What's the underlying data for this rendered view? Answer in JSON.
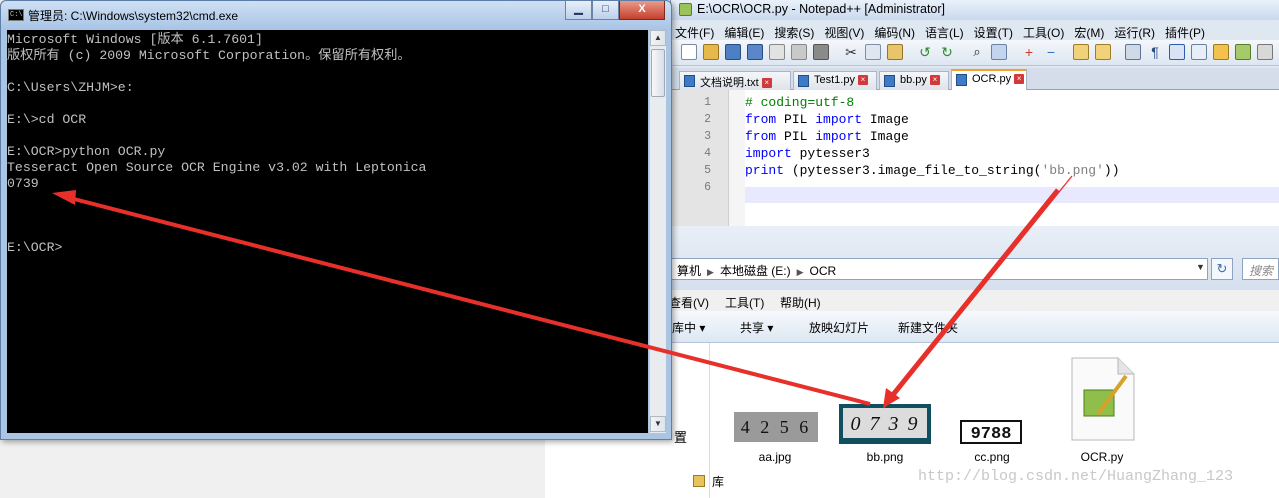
{
  "cmd": {
    "title": "管理员: C:\\Windows\\system32\\cmd.exe",
    "controls": {
      "minimize": "▁",
      "maximize": "□",
      "close": "X"
    },
    "lines": [
      "Microsoft Windows [版本 6.1.7601]",
      "版权所有 (c) 2009 Microsoft Corporation。保留所有权利。",
      "",
      "C:\\Users\\ZHJM>e:",
      "",
      "E:\\>cd OCR",
      "",
      "E:\\OCR>python OCR.py",
      "Tesseract Open Source OCR Engine v3.02 with Leptonica",
      "0739",
      "",
      "",
      "",
      "E:\\OCR>"
    ]
  },
  "notepad": {
    "title": "E:\\OCR\\OCR.py - Notepad++ [Administrator]",
    "menu": [
      "文件(F)",
      "编辑(E)",
      "搜索(S)",
      "视图(V)",
      "编码(N)",
      "语言(L)",
      "设置(T)",
      "工具(O)",
      "宏(M)",
      "运行(R)",
      "插件(P)"
    ],
    "tabs": [
      "文档说明.txt",
      "Test1.py",
      "bb.py",
      "OCR.py"
    ],
    "active_tab": "OCR.py",
    "line_numbers": [
      "1",
      "2",
      "3",
      "4",
      "5",
      "6"
    ],
    "code": [
      {
        "t": "cm",
        "s": "# coding=utf-8"
      },
      {
        "parts": [
          {
            "c": "kw",
            "s": "from"
          },
          {
            "c": "",
            "s": " PIL "
          },
          {
            "c": "kw",
            "s": "import"
          },
          {
            "c": "",
            "s": " Image"
          }
        ]
      },
      {
        "parts": [
          {
            "c": "kw",
            "s": "from"
          },
          {
            "c": "",
            "s": " PIL "
          },
          {
            "c": "kw",
            "s": "import"
          },
          {
            "c": "",
            "s": " Image"
          }
        ]
      },
      {
        "parts": [
          {
            "c": "kw",
            "s": "import"
          },
          {
            "c": "",
            "s": " pytesser3"
          }
        ]
      },
      {
        "parts": [
          {
            "c": "kw",
            "s": "print"
          },
          {
            "c": "",
            "s": " (pytesser3.image_file_to_string("
          },
          {
            "c": "st",
            "s": "'bb.png'"
          },
          {
            "c": "",
            "s": "))"
          }
        ]
      },
      {
        "parts": []
      }
    ]
  },
  "explorer": {
    "breadcrumb": [
      "算机",
      "本地磁盘 (E:)",
      "OCR"
    ],
    "search_placeholder": "搜索",
    "menu": [
      "查看(V)",
      "工具(T)",
      "帮助(H)"
    ],
    "commands": [
      "库中 ▾",
      "共享 ▾",
      "放映幻灯片",
      "新建文件夹"
    ],
    "side_items": [
      "置",
      "库"
    ],
    "files": [
      {
        "name": "aa.jpg",
        "text": "4 2 5 6"
      },
      {
        "name": "bb.png",
        "text": "0 7 3 9"
      },
      {
        "name": "cc.png",
        "text": "9788"
      },
      {
        "name": "OCR.py",
        "text": ""
      }
    ]
  },
  "watermark": "http://blog.csdn.net/HuangZhang_123",
  "colors": {
    "arrow": "#e8302a",
    "cmd_bg": "#000000",
    "cmd_fg": "#c0c0c0",
    "keyword": "#0000ff",
    "comment": "#008000"
  }
}
